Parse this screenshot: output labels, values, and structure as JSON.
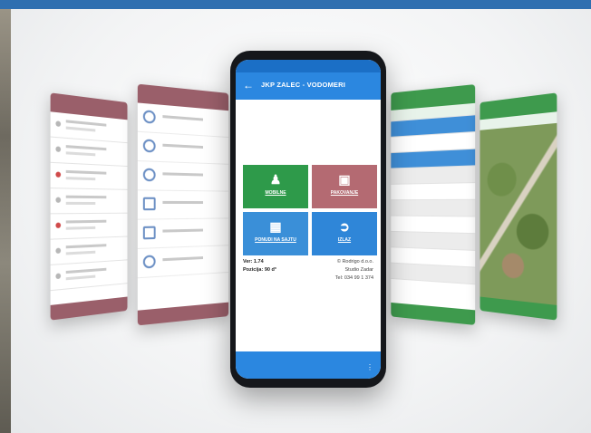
{
  "main_phone": {
    "title": "JKP ZALEC - VODOMERI",
    "back_glyph": "←",
    "tiles": [
      {
        "label": "MOBILNE",
        "icon": "person-icon",
        "color": "#2e9a4a"
      },
      {
        "label": "PAKOVANJE",
        "icon": "box-icon",
        "color": "#b46a72"
      },
      {
        "label": "PONUDI NA SAJTU",
        "icon": "grid-icon",
        "color": "#3a8fd8"
      },
      {
        "label": "IZLAZ",
        "icon": "exit-icon",
        "color": "#2f86d8"
      }
    ],
    "info_left": [
      "Ver: 1.74",
      "Pozicija: 90 d°"
    ],
    "info_right": [
      "© Rodrigo d.o.o.",
      "Studio Zadar",
      "Tel: 034 99 1 374"
    ],
    "menu_glyph": "⋮"
  },
  "colors": {
    "accent_blue": "#2b87e0",
    "green": "#2e9a4a",
    "maroon": "#b46a72",
    "top_bar": "#2f6fb0"
  }
}
